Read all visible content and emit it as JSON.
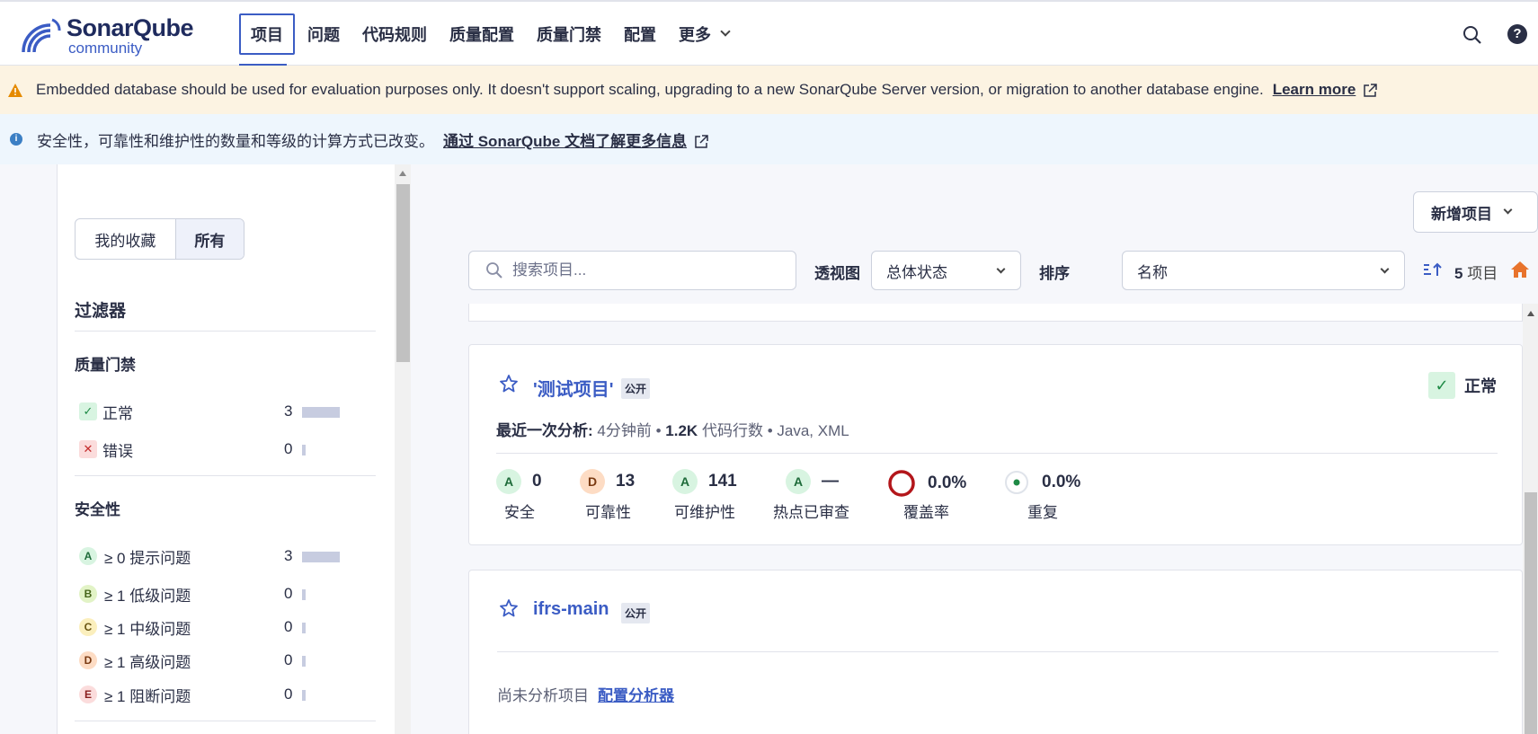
{
  "app": {
    "logo_name": "SonarQube",
    "logo_edition": "community"
  },
  "nav": {
    "items": [
      {
        "label": "项目",
        "active": true
      },
      {
        "label": "问题"
      },
      {
        "label": "代码规则"
      },
      {
        "label": "质量配置"
      },
      {
        "label": "质量门禁"
      },
      {
        "label": "配置"
      },
      {
        "label": "更多"
      }
    ]
  },
  "warning_banner": {
    "text": "Embedded database should be used for evaluation purposes only. It doesn't support scaling, upgrading to a new SonarQube Server version, or migration to another database engine.",
    "link": "Learn more"
  },
  "info_banner": {
    "text": "安全性，可靠性和维护性的数量和等级的计算方式已改变。",
    "link": "通过 SonarQube 文档了解更多信息"
  },
  "sidebar": {
    "toggle": {
      "favorites": "我的收藏",
      "all": "所有"
    },
    "filters_title": "过滤器",
    "quality_gate": {
      "title": "质量门禁",
      "items": [
        {
          "label": "正常",
          "count": "3",
          "ratio": 1.0
        },
        {
          "label": "错误",
          "count": "0",
          "ratio": 0
        }
      ]
    },
    "security": {
      "title": "安全性",
      "items": [
        {
          "grade": "A",
          "label": "≥ 0 提示问题",
          "count": "3",
          "ratio": 1.0
        },
        {
          "grade": "B",
          "label": "≥ 1 低级问题",
          "count": "0",
          "ratio": 0
        },
        {
          "grade": "C",
          "label": "≥ 1 中级问题",
          "count": "0",
          "ratio": 0
        },
        {
          "grade": "D",
          "label": "≥ 1 高级问题",
          "count": "0",
          "ratio": 0
        },
        {
          "grade": "E",
          "label": "≥ 1 阻断问题",
          "count": "0",
          "ratio": 0
        }
      ]
    }
  },
  "toolbar": {
    "new_project": "新增项目",
    "search_placeholder": "搜索项目...",
    "perspective_label": "透视图",
    "perspective_value": "总体状态",
    "sort_label": "排序",
    "sort_value": "名称",
    "project_count": "5",
    "project_count_unit": "项目"
  },
  "projects": [
    {
      "name": "'测试项目'",
      "visibility": "公开",
      "status": "正常",
      "last_analysis_label": "最近一次分析:",
      "last_analysis": "4分钟前",
      "loc": "1.2K",
      "loc_label": "代码行数",
      "languages": "Java, XML",
      "metrics": [
        {
          "grade": "A",
          "value": "0",
          "label": "安全"
        },
        {
          "grade": "D",
          "value": "13",
          "label": "可靠性"
        },
        {
          "grade": "A",
          "value": "141",
          "label": "可维护性"
        },
        {
          "grade": "A",
          "value": "—",
          "label": "热点已审查"
        },
        {
          "value": "0.0%",
          "label": "覆盖率"
        },
        {
          "value": "0.0%",
          "label": "重复"
        }
      ]
    },
    {
      "name": "ifrs-main",
      "visibility": "公开",
      "not_analyzed": "尚未分析项目",
      "configure_link": "配置分析器"
    }
  ],
  "colors": {
    "accent": "#3b5cc4",
    "warning_bg": "#fcf3e2",
    "info_bg": "#eef6fd",
    "ok_green": "#1e8a45",
    "coverage_red": "#b3161b"
  }
}
